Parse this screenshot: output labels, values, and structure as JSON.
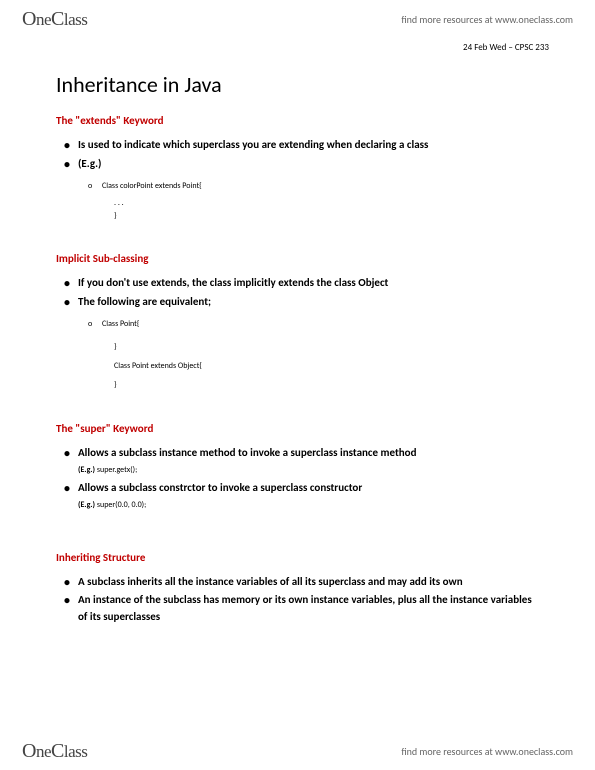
{
  "brand": "OneClass",
  "tagline": "find more resources at www.oneclass.com",
  "date_line": "24 Feb Wed – CPSC 233",
  "title": "Inheritance in Java",
  "sections": {
    "extends": {
      "heading": "The \"extends\" Keyword",
      "b1": "Is used to indicate which superclass you are extending when declaring a class",
      "b2": "(E.g.)",
      "sub1": "Class colorPoint extends Point{",
      "code1": ". . .",
      "code2": "}"
    },
    "implicit": {
      "heading": "Implicit Sub-classing",
      "b1": "If you don't use extends, the class implicitly extends the class Object",
      "b2": "The following are equivalent;",
      "sub1": "Class Point{",
      "code1": "}",
      "code2": "Class Point extends Object{",
      "code3": "}"
    },
    "super": {
      "heading": "The \"super\" Keyword",
      "b1": "Allows a subclass instance method to invoke a superclass instance method",
      "eg1_label": "(E.g.) ",
      "eg1_code": "super.getx();",
      "b2": "Allows a subclass constrctor to invoke a superclass constructor",
      "eg2_label": "(E.g.) ",
      "eg2_code": "super(0.0, 0.0);"
    },
    "inherit": {
      "heading": "Inheriting Structure",
      "b1": "A subclass inherits all the instance variables of all its superclass and may add its own",
      "b2": "An instance of the subclass has memory or its own instance variables, plus all the instance variables of its superclasses"
    }
  }
}
